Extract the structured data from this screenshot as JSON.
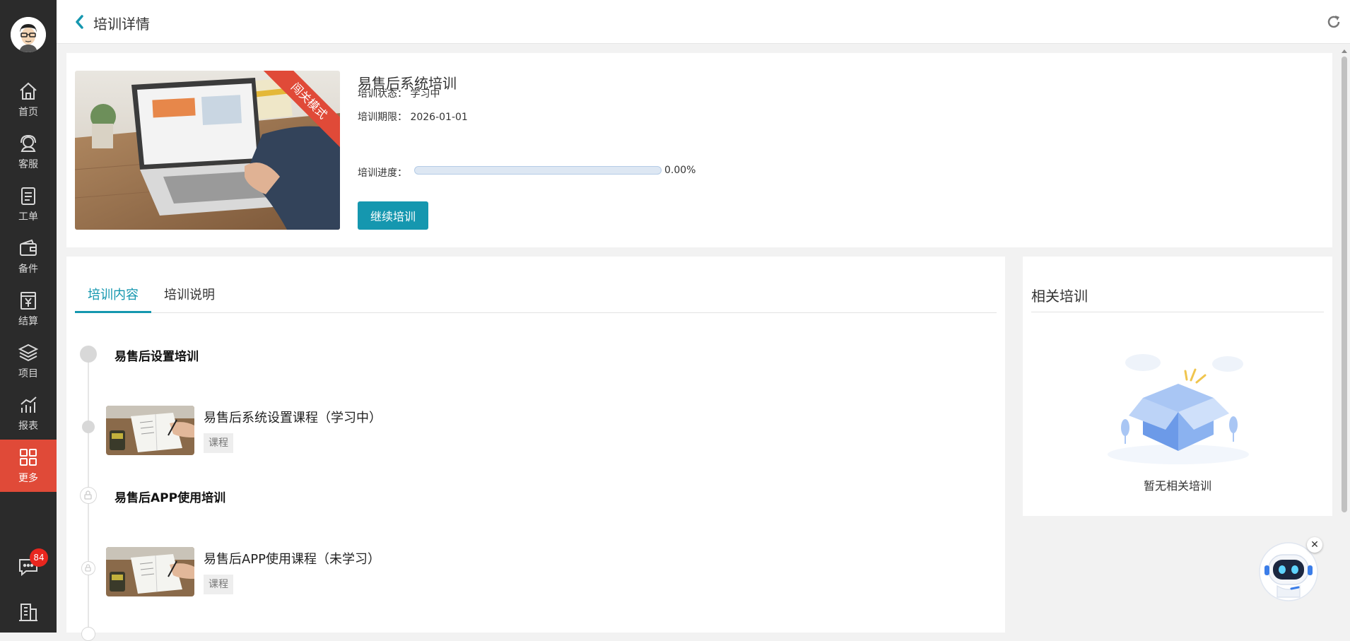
{
  "sidebar": {
    "items": [
      {
        "label": "首页"
      },
      {
        "label": "客服"
      },
      {
        "label": "工单"
      },
      {
        "label": "备件"
      },
      {
        "label": "结算"
      },
      {
        "label": "项目"
      },
      {
        "label": "报表"
      },
      {
        "label": "更多"
      }
    ],
    "message_badge": "84"
  },
  "header": {
    "title": "培训详情"
  },
  "training": {
    "title": "易售后系统培训",
    "ribbon": "闯关模式",
    "status_label": "培训状态：",
    "status_value": "学习中",
    "deadline_label": "培训期限：",
    "deadline_value": "2026-01-01",
    "progress_label": "培训进度：",
    "progress_value": 0,
    "progress_text": "0.00%",
    "continue_button": "继续培训"
  },
  "tabs": [
    {
      "label": "培训内容",
      "active": true
    },
    {
      "label": "培训说明",
      "active": false
    }
  ],
  "sections": [
    {
      "title": "易售后设置培训",
      "locked": false,
      "course": {
        "title": "易售后系统设置课程（学习中）",
        "tag": "课程"
      }
    },
    {
      "title": "易售后APP使用培训",
      "locked": true,
      "course": {
        "title": "易售后APP使用课程（未学习）",
        "tag": "课程"
      }
    }
  ],
  "related": {
    "title": "相关培训",
    "empty_text": "暂无相关培训"
  },
  "colors": {
    "sidebar_bg": "#2b2b2b",
    "active_red": "#e04a38",
    "accent_teal": "#1597af"
  }
}
